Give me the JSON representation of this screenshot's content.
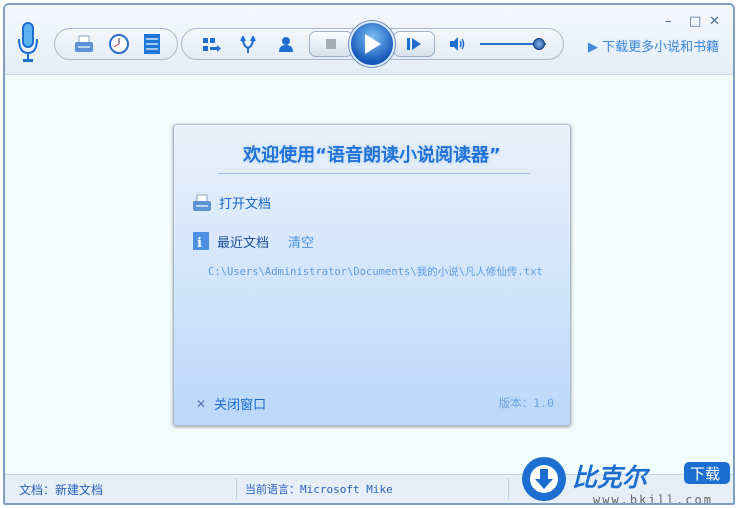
{
  "toolbar": {
    "download_link": "下载更多小说和书籍"
  },
  "dialog": {
    "title": "欢迎使用“语音朗读小说阅读器”",
    "open_doc": "打开文档",
    "recent_docs": "最近文档",
    "clear": "清空",
    "recent_path": "C:\\Users\\Administrator\\Documents\\我的小说\\凡人修仙传.txt",
    "close_window": "关闭窗口",
    "version": "版本：1.0"
  },
  "status": {
    "doc": "文档：新建文档",
    "language": "当前语言：Microsoft Mike"
  },
  "watermark": {
    "brand": "比克尔",
    "badge": "下载",
    "url": "www.bkill.com"
  },
  "volume_level": 0.9
}
